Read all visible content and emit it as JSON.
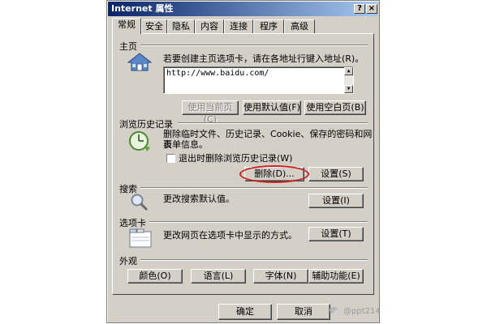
{
  "window": {
    "title": "Internet 属性",
    "help_btn": "?",
    "close_btn": "×"
  },
  "tabs": [
    "常规",
    "安全",
    "隐私",
    "内容",
    "连接",
    "程序",
    "高级"
  ],
  "home": {
    "label": "主页",
    "description": "若要创建主页选项卡，请在各地址行键入地址(R)。",
    "url": "http://www.baidu.com/",
    "use_current": "使用当前页(C)",
    "use_default": "使用默认值(F)",
    "use_blank": "使用空白页(B)"
  },
  "history": {
    "label": "浏览历史记录",
    "description_line1": "删除临时文件、历史记录、Cookie、保存的密码和网页",
    "description_line2": "表单信息。",
    "checkbox_label": "退出时删除浏览历史记录(W)",
    "delete": "删除(D)...",
    "settings": "设置(S)"
  },
  "search": {
    "label": "搜索",
    "description": "更改搜索默认值。",
    "settings": "设置(I)"
  },
  "tabs_group": {
    "label": "选项卡",
    "description": "更改网页在选项卡中显示的方式。",
    "settings": "设置(T)"
  },
  "appearance": {
    "label": "外观",
    "colors": "颜色(O)",
    "languages": "语言(L)",
    "fonts": "字体(N)",
    "accessibility": "辅助功能(E)"
  },
  "footer": {
    "ok": "确定",
    "cancel": "取消"
  },
  "watermark": {
    "text": "@ppt214"
  },
  "colors": {
    "title_start": "#0a246a",
    "title_end": "#a6caf0",
    "highlight": "#cc1f1f"
  }
}
